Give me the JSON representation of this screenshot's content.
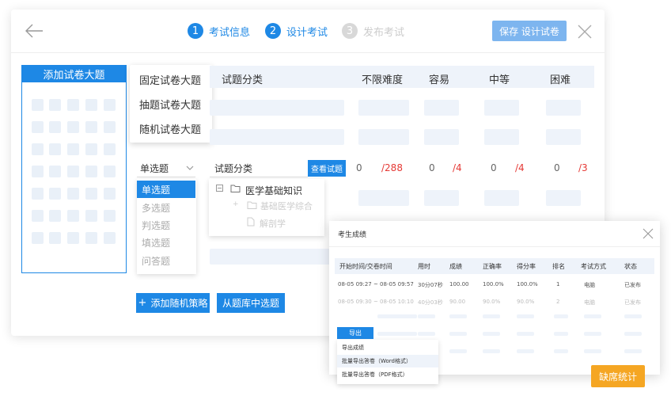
{
  "steps": [
    {
      "num": "1",
      "label": "考试信息"
    },
    {
      "num": "2",
      "label": "设计考试"
    },
    {
      "num": "3",
      "label": "发布考试"
    }
  ],
  "header": {
    "save_label": "保存 设计试卷"
  },
  "left_panel": {
    "add_section_label": "添加试卷大题"
  },
  "section_menu": {
    "items": [
      "固定试卷大题",
      "抽题试卷大题",
      "随机试卷大题"
    ]
  },
  "table_header": {
    "category": "试题分类",
    "any": "不限难度",
    "easy": "容易",
    "medium": "中等",
    "hard": "困难"
  },
  "strategy_row": {
    "type_select": "单选题",
    "category_input": "试题分类",
    "view_button": "查看试题",
    "any": {
      "value": "0",
      "total": "/288"
    },
    "easy": {
      "value": "0",
      "total": "/4"
    },
    "medium": {
      "value": "0",
      "total": "/4"
    },
    "hard": {
      "value": "0",
      "total": "/3"
    }
  },
  "type_dropdown": {
    "options": [
      "单选题",
      "多选题",
      "判选题",
      "填选题",
      "问答题"
    ],
    "selected": "单选题"
  },
  "category_tree": {
    "root": "医学基础知识",
    "child": "基础医学综合",
    "leaf": "解剖学"
  },
  "bottom_buttons": {
    "add_strategy": "添加随机策略",
    "from_bank": "从题库中选题"
  },
  "scores_modal": {
    "title": "考生成绩",
    "columns": [
      "开始时间/交卷时间",
      "用时",
      "成绩",
      "正确率",
      "得分率",
      "排名",
      "考试方式",
      "状态"
    ],
    "rows": [
      [
        "08-05 09:27 ~ 08-05 09:57",
        "30分07秒",
        "100.00",
        "100.0%",
        "100.0%",
        "1",
        "电脑",
        "已发布"
      ],
      [
        "08-05 09:30 ~ 08-05 10:10",
        "40分03秒",
        "90.00",
        "90.0%",
        "90.0%",
        "2",
        "电脑",
        "已发布"
      ]
    ],
    "export_button": "导出",
    "export_menu": [
      "导出成绩",
      "批量导出答卷（Word格式）",
      "批量导出答卷（PDF格式）"
    ],
    "absent_button": "缺席统计"
  },
  "colors": {
    "primary": "#1e88e5",
    "light_blue": "#7db5ef",
    "red": "#e53935",
    "orange": "#f5a623",
    "placeholder": "#eef3fa"
  }
}
